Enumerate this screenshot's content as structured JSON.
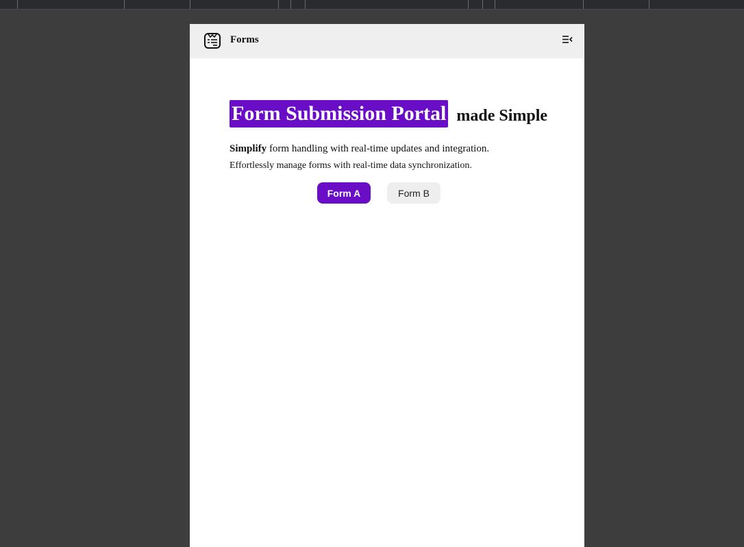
{
  "navbar": {
    "brand": "Forms",
    "logo_icon": "form-document-icon",
    "menu_icon": "menu-collapse-icon"
  },
  "hero": {
    "highlight": "Form Submission Portal",
    "rest": "made Simple",
    "desc_bold": "Simplify",
    "desc_rest": " form handling with real-time updates and integration.",
    "subtitle": "Effortlessly manage forms with real-time data synchronization."
  },
  "buttons": {
    "form_a": "Form A",
    "form_b": "Form B"
  },
  "colors": {
    "accent": "#6a0dc6",
    "navbar_bg": "#efefef",
    "page_bg": "#3d3d3d"
  }
}
